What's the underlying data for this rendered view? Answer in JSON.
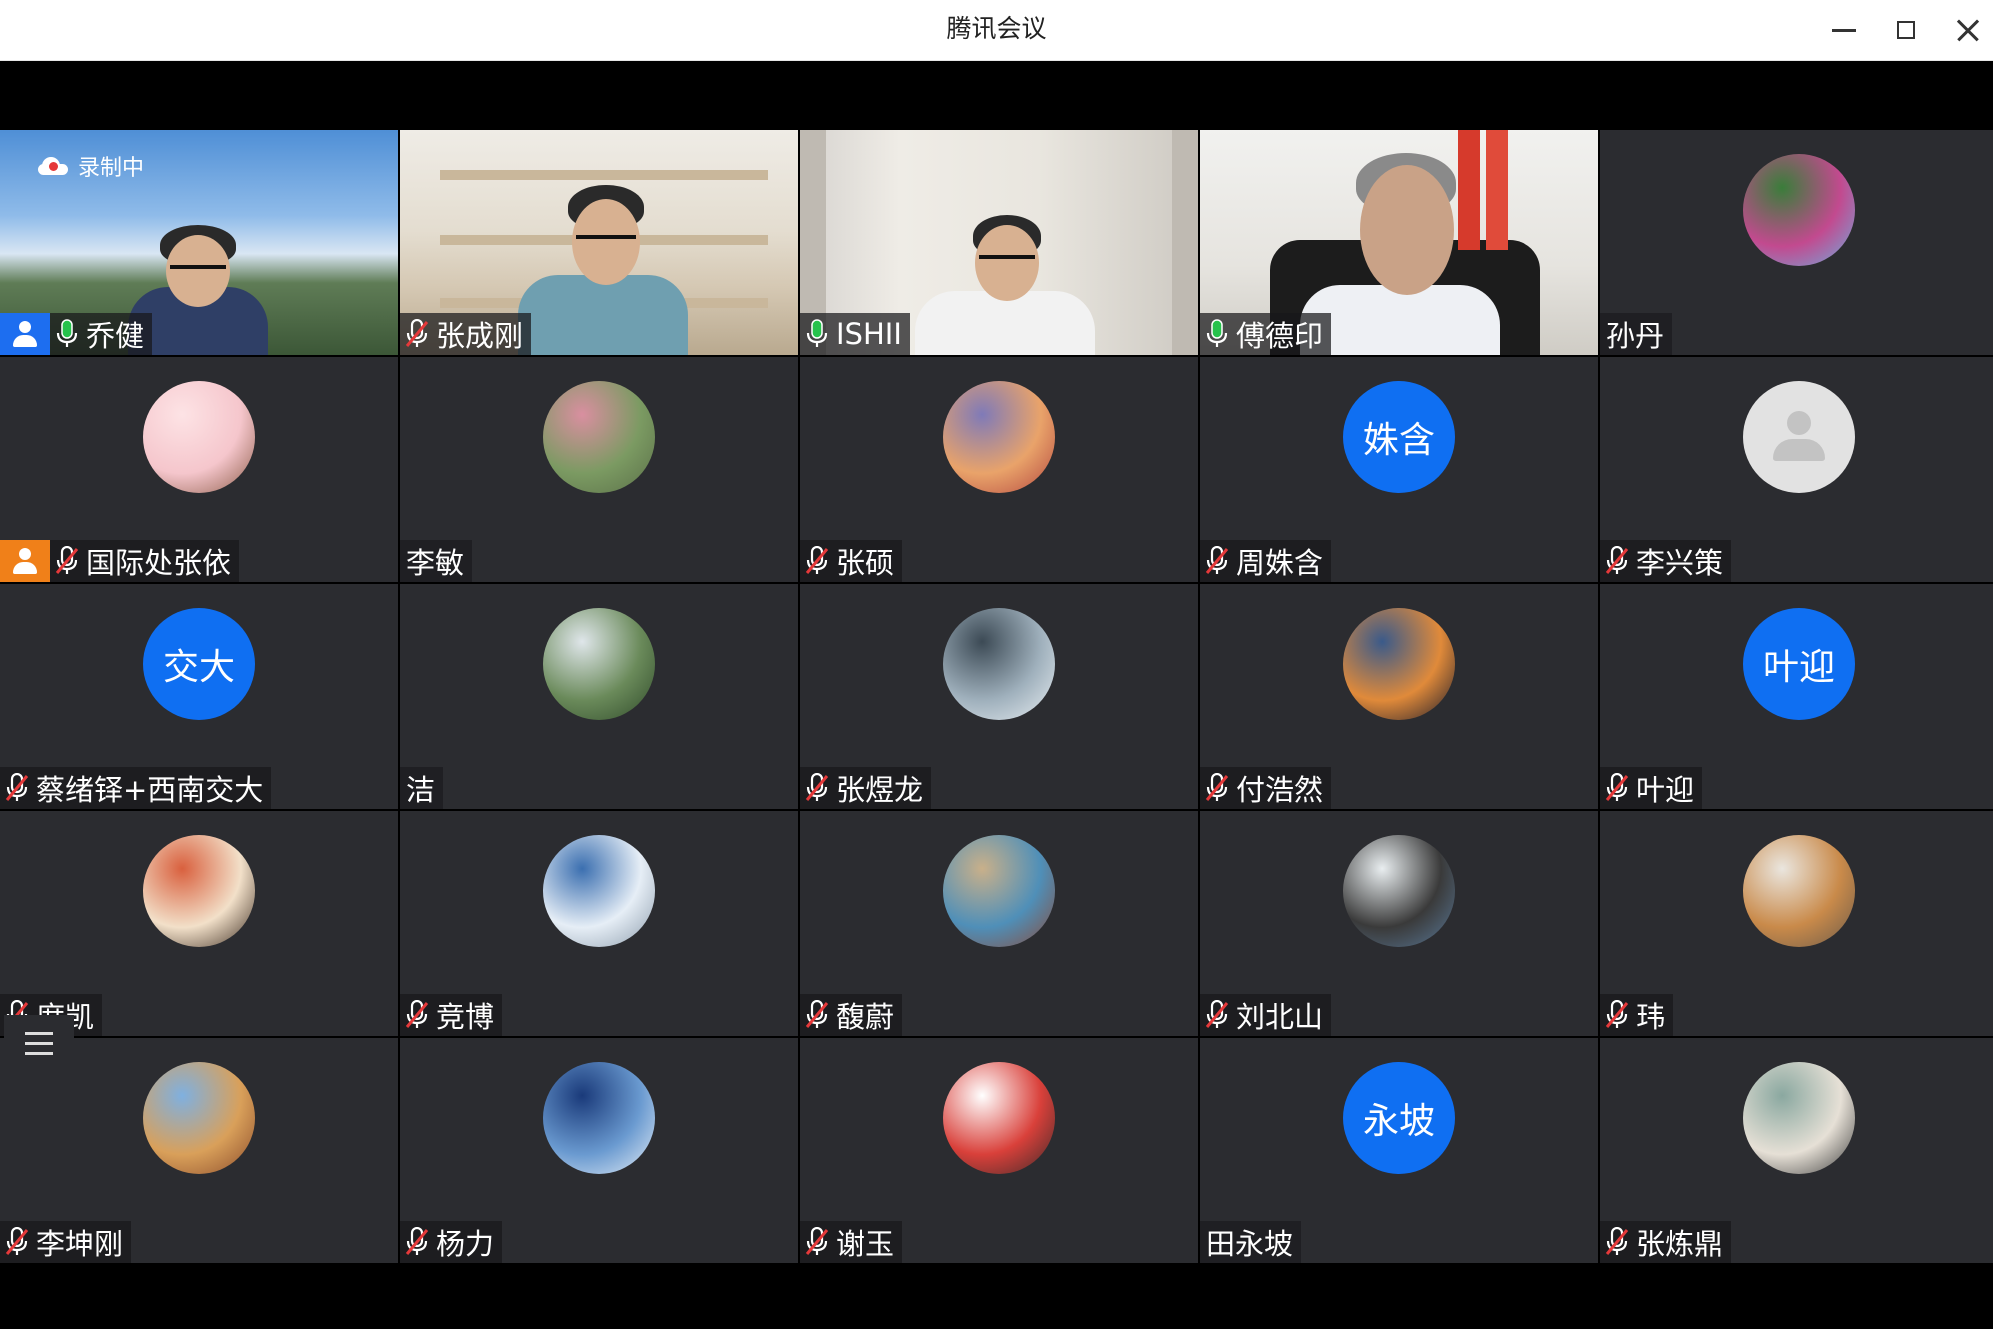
{
  "window": {
    "title": "腾讯会议"
  },
  "recording": {
    "label": "录制中"
  },
  "participants": [
    {
      "name": "乔健",
      "type": "video",
      "video": "sky",
      "mic": "on",
      "badge": "host"
    },
    {
      "name": "张成刚",
      "type": "video",
      "video": "shelf",
      "mic": "muted"
    },
    {
      "name": "ISHII",
      "type": "video",
      "video": "curtain",
      "mic": "on"
    },
    {
      "name": "傅德印",
      "type": "video",
      "video": "office",
      "mic": "on",
      "active_speaker": true
    },
    {
      "name": "孙丹",
      "type": "avatar",
      "avatar": "photo",
      "colors": [
        "#3a7d3a",
        "#c24a8f",
        "#6ab0e0"
      ],
      "mic": "none"
    },
    {
      "name": "国际处张依",
      "type": "avatar",
      "avatar": "photo",
      "colors": [
        "#fde3e5",
        "#f5c6cc",
        "#8a5a45"
      ],
      "mic": "muted",
      "badge": "cohost"
    },
    {
      "name": "李敏",
      "type": "avatar",
      "avatar": "photo",
      "colors": [
        "#d98fa0",
        "#7b9a62",
        "#5a6f48"
      ],
      "mic": "none"
    },
    {
      "name": "张硕",
      "type": "avatar",
      "avatar": "photo",
      "colors": [
        "#7f7ab8",
        "#e9a36a",
        "#b3463f"
      ],
      "mic": "muted"
    },
    {
      "name": "周姝含",
      "type": "avatar",
      "avatar": "text",
      "avatar_text": "姝含",
      "mic": "muted"
    },
    {
      "name": "李兴策",
      "type": "avatar",
      "avatar": "default",
      "mic": "muted"
    },
    {
      "name": "蔡绪铎+西南交大",
      "type": "avatar",
      "avatar": "text",
      "avatar_text": "交大",
      "mic": "muted"
    },
    {
      "name": "洁",
      "type": "avatar",
      "avatar": "photo",
      "colors": [
        "#dfe6ea",
        "#6a8a5a",
        "#2f4a2a"
      ],
      "mic": "none"
    },
    {
      "name": "张煜龙",
      "type": "avatar",
      "avatar": "photo",
      "colors": [
        "#3c4a55",
        "#9fb0bc",
        "#e8eef2"
      ],
      "mic": "muted"
    },
    {
      "name": "付浩然",
      "type": "avatar",
      "avatar": "photo",
      "colors": [
        "#3a5a8a",
        "#e08a3a",
        "#1a1a2a"
      ],
      "mic": "muted"
    },
    {
      "name": "叶迎",
      "type": "avatar",
      "avatar": "text",
      "avatar_text": "叶迎",
      "mic": "muted"
    },
    {
      "name": "席凯",
      "type": "avatar",
      "avatar": "photo",
      "colors": [
        "#d9603e",
        "#f2e0c9",
        "#3a2a1e"
      ],
      "mic": "muted"
    },
    {
      "name": "竞博",
      "type": "avatar",
      "avatar": "photo",
      "colors": [
        "#3b6fb0",
        "#e6eef6",
        "#8a9aaa"
      ],
      "mic": "muted"
    },
    {
      "name": "馥蔚",
      "type": "avatar",
      "avatar": "photo",
      "colors": [
        "#c9b08a",
        "#4f8fb8",
        "#8a4a3a"
      ],
      "mic": "muted"
    },
    {
      "name": "刘北山",
      "type": "avatar",
      "avatar": "photo",
      "colors": [
        "#e9eef0",
        "#3a3a3a",
        "#5a7a9a"
      ],
      "mic": "muted"
    },
    {
      "name": "玮",
      "type": "avatar",
      "avatar": "photo",
      "colors": [
        "#eae6df",
        "#c98a4a",
        "#6a5a4a"
      ],
      "mic": "muted"
    },
    {
      "name": "李坤刚",
      "type": "avatar",
      "avatar": "photo",
      "colors": [
        "#7fb0e0",
        "#d9a05a",
        "#8a4a2a"
      ],
      "mic": "muted"
    },
    {
      "name": "杨力",
      "type": "avatar",
      "avatar": "photo",
      "colors": [
        "#1a3a7a",
        "#6a9ad0",
        "#e6eef6"
      ],
      "mic": "muted"
    },
    {
      "name": "谢玉",
      "type": "avatar",
      "avatar": "photo",
      "colors": [
        "#ffffff",
        "#d9403a",
        "#3a2a2a"
      ],
      "mic": "muted"
    },
    {
      "name": "田永坡",
      "type": "avatar",
      "avatar": "text",
      "avatar_text": "永坡",
      "mic": "none"
    },
    {
      "name": "张炼鼎",
      "type": "avatar",
      "avatar": "photo",
      "colors": [
        "#8aa8a0",
        "#e6e0d6",
        "#3a3a3a"
      ],
      "mic": "muted"
    }
  ],
  "colors": {
    "tile_bg": "#2b2c30",
    "active_outline": "#27c24c",
    "avatar_blue": "#0f6ff2",
    "host_badge": "#1d6ef0",
    "cohost_badge": "#f08019",
    "mic_on": "#27c24c",
    "mic_muted_slash": "#e5393a"
  },
  "icons": {
    "minimize": "minimize-icon",
    "maximize": "maximize-icon",
    "close": "close-icon",
    "recording": "cloud-record-icon",
    "mic_on": "microphone-icon",
    "mic_muted": "microphone-muted-icon",
    "host": "host-user-icon",
    "member_list": "list-icon"
  }
}
